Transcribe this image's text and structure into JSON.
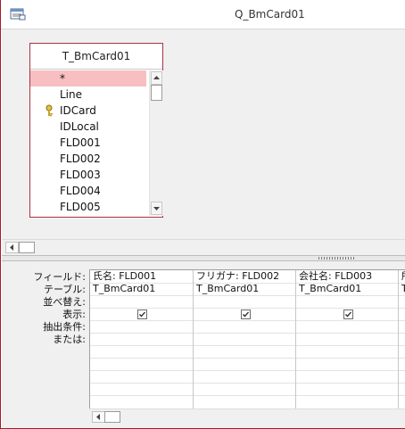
{
  "window": {
    "title": "Q_BmCard01"
  },
  "table": {
    "name": "T_BmCard01",
    "fields": [
      "*",
      "Line",
      "IDCard",
      "IDLocal",
      "FLD001",
      "FLD002",
      "FLD003",
      "FLD004",
      "FLD005"
    ],
    "key_field_index": 2,
    "selected_field_index": 0
  },
  "grid": {
    "row_labels": [
      "フィールド:",
      "テーブル:",
      "並べ替え:",
      "表示:",
      "抽出条件:",
      "または:"
    ],
    "columns": [
      {
        "field": "氏名: FLD001",
        "table": "T_BmCard01",
        "sort": "",
        "show": true
      },
      {
        "field": "フリガナ: FLD002",
        "table": "T_BmCard01",
        "sort": "",
        "show": true
      },
      {
        "field": "会社名: FLD003",
        "table": "T_BmCard01",
        "sort": "",
        "show": true
      },
      {
        "field": "所",
        "table": "T",
        "sort": "",
        "show": true
      }
    ]
  },
  "icons": {
    "window_icon": "query-window-icon",
    "key_icon": "primary-key-icon",
    "check_icon": "checkbox-checked-icon"
  },
  "colors": {
    "accent": "#a11c2c",
    "selected_field": "#f7bfc1"
  }
}
